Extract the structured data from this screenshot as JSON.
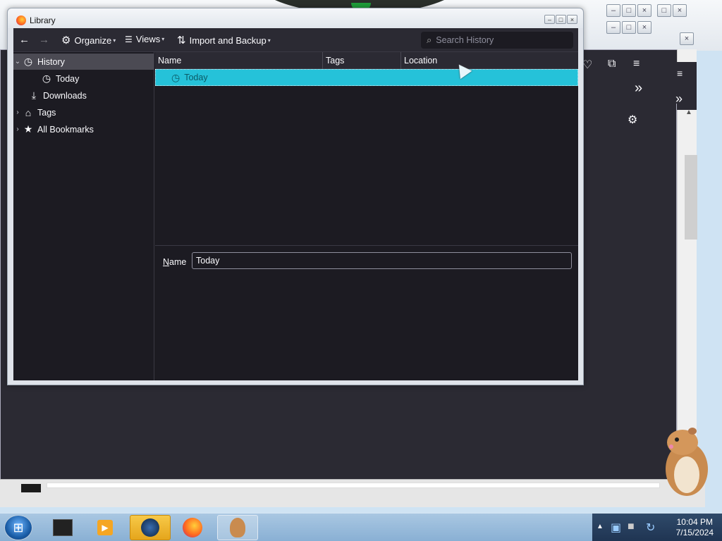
{
  "library": {
    "title": "Library",
    "toolbar": {
      "back_icon": "←",
      "forward_icon": "→",
      "organize_label": "Organize",
      "views_label": "Views",
      "import_label": "Import and Backup",
      "search_placeholder": "Search History"
    },
    "tree": [
      {
        "label": "History",
        "icon": "clock-icon",
        "twisty": "v",
        "selected": true
      },
      {
        "label": "Today",
        "icon": "clock-icon",
        "twisty": "",
        "selected": false
      },
      {
        "label": "Downloads",
        "icon": "download-icon",
        "twisty": "",
        "selected": false
      },
      {
        "label": "Tags",
        "icon": "tag-icon",
        "twisty": ">",
        "selected": false
      },
      {
        "label": "All Bookmarks",
        "icon": "star-icon",
        "twisty": ">",
        "selected": false
      }
    ],
    "columns": [
      "Name",
      "Tags",
      "Location"
    ],
    "rows": [
      {
        "name": "Today",
        "tags": "",
        "location": ""
      }
    ],
    "details": {
      "name_label_accel": "N",
      "name_label_rest": "ame",
      "name_value": "Today"
    }
  },
  "taskbar": {
    "time": "10:04 PM",
    "date": "7/15/2024"
  },
  "colors": {
    "selection": "#25c2d9",
    "panel_bg": "#1c1b22",
    "toolbar_bg": "#2b2a33"
  }
}
